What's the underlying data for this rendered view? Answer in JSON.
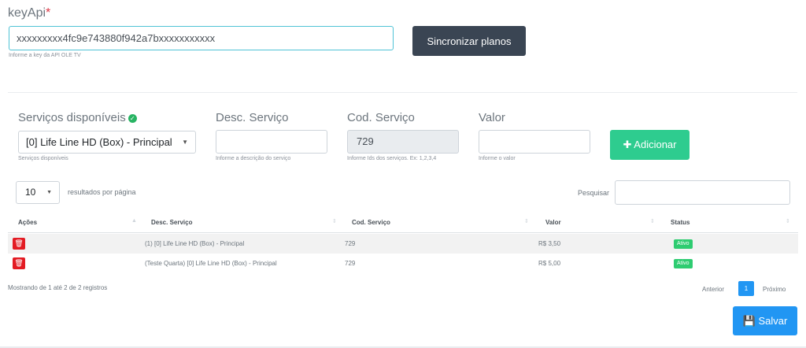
{
  "key": {
    "label": "keyApi",
    "required_mark": "*",
    "value": "xxxxxxxxx4fc9e743880f942a7bxxxxxxxxxxx",
    "help": "Informe a key da API OLE TV"
  },
  "sync_button": "Sincronizar planos",
  "form": {
    "services_label": "Serviços disponíveis",
    "services_selected": "[0] Life Line HD (Box) - Principal",
    "services_help": "Serviços disponíveis",
    "desc_label": "Desc. Serviço",
    "desc_value": "",
    "desc_help": "Informe a descrição do serviço",
    "cod_label": "Cod. Serviço",
    "cod_value": "729",
    "cod_help": "Informe Ids dos serviços. Ex: 1,2,3,4",
    "valor_label": "Valor",
    "valor_value": "",
    "valor_help": "Informe o valor",
    "add_button": "Adicionar"
  },
  "table_controls": {
    "page_length": "10",
    "length_text": "resultados por página",
    "search_label": "Pesquisar",
    "search_value": ""
  },
  "table": {
    "headers": [
      "Ações",
      "Desc. Serviço",
      "Cod. Serviço",
      "Valor",
      "Status"
    ],
    "rows": [
      {
        "desc": "(1) [0] Life Line HD (Box) - Principal",
        "cod": "729",
        "valor": "R$ 3,50",
        "status": "Ativo"
      },
      {
        "desc": "(Teste Quarta) [0] Life Line HD (Box) - Principal",
        "cod": "729",
        "valor": "R$ 5,00",
        "status": "Ativo"
      }
    ]
  },
  "pagination": {
    "info": "Mostrando de 1 até 2 de 2 registros",
    "prev": "Anterior",
    "current": "1",
    "next": "Próximo"
  },
  "save_button": "Salvar",
  "colors": {
    "primary": "#2196f3",
    "success": "#2ecc8f",
    "danger": "#e31b23",
    "dark": "#3a4553"
  }
}
